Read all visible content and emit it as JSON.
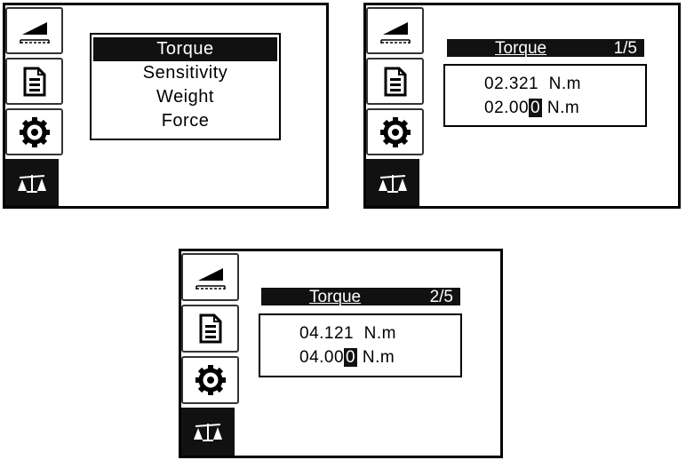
{
  "sidebar": {
    "icons": [
      "calibrate-ramp-icon",
      "document-icon",
      "gear-icon",
      "balance-scale-icon"
    ],
    "active_icon": "balance-scale-icon"
  },
  "screen1": {
    "menu": {
      "items": [
        "Torque",
        "Sensitivity",
        "Weight",
        "Force"
      ],
      "selected": "Torque"
    }
  },
  "screen2": {
    "title": "Torque",
    "page": "1/5",
    "measured": "02.321  N.m",
    "target": {
      "prefix": "02.00",
      "cursor": "0",
      "unit": " N.m"
    }
  },
  "screen3": {
    "title": "Torque",
    "page": "2/5",
    "measured": "04.121  N.m",
    "target": {
      "prefix": "04.00",
      "cursor": "0",
      "unit": " N.m"
    }
  }
}
